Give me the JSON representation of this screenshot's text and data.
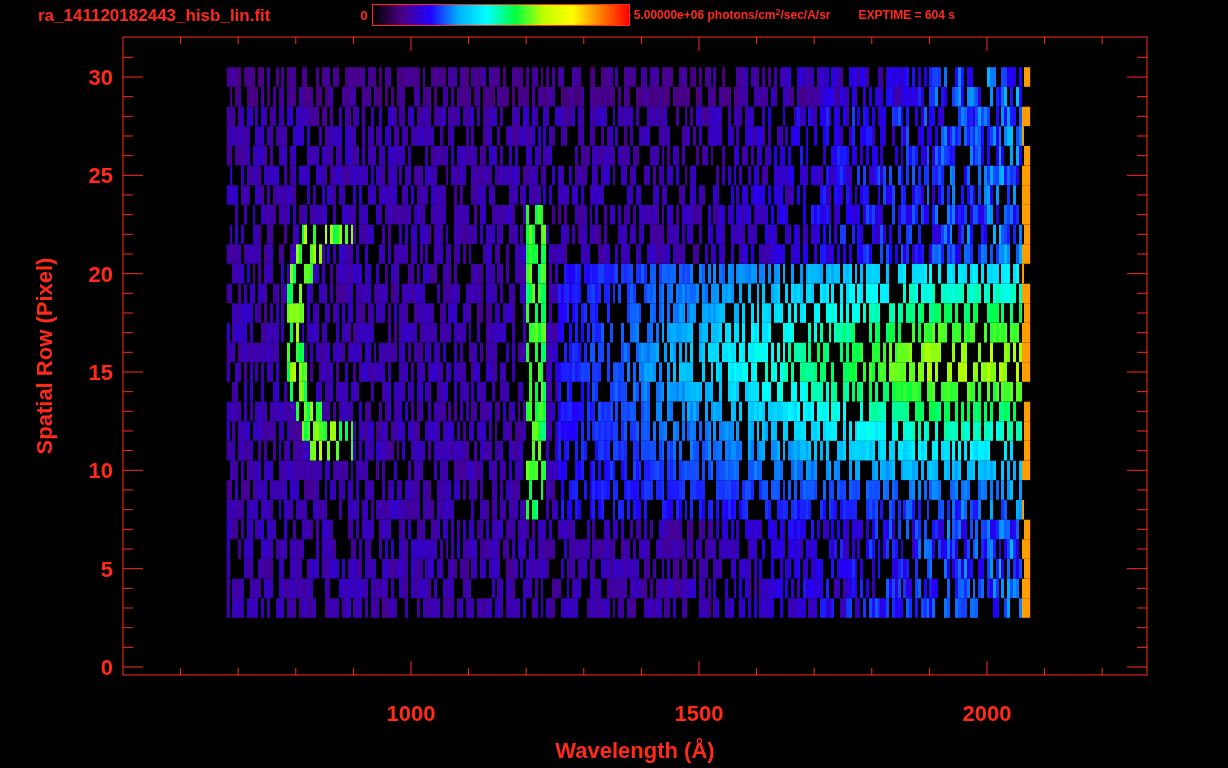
{
  "title": "ra_141120182443_hisb_lin.fit",
  "colorbar": {
    "min_label": "0",
    "max_label": "5.00000e+06 photons/cm$^{2}$/sec/A/sr"
  },
  "exptime": "EXPTIME = 604 s",
  "x_axis": {
    "label": "Wavelength (Å)",
    "ticks": [
      "1000",
      "1500",
      "2000"
    ]
  },
  "y_axis": {
    "label": "Spatial Row (Pixel)",
    "ticks": [
      "30",
      "25",
      "20",
      "15",
      "10",
      "5",
      "0"
    ]
  }
}
